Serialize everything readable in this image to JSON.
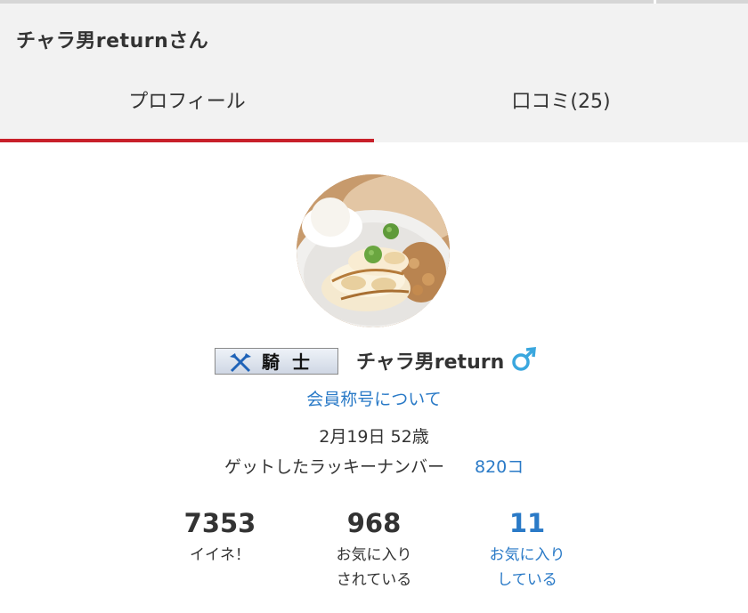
{
  "header": {
    "title": "チャラ男returnさん"
  },
  "tabs": [
    {
      "label": "プロフィール",
      "active": true
    },
    {
      "label": "口コミ(25)",
      "active": false
    }
  ],
  "colors": {
    "accent_red": "#c8202a",
    "link_blue": "#2a7ac7",
    "header_bg": "#f2f2f2"
  },
  "profile": {
    "avatar_icon": "pancake-photo-avatar",
    "badge": {
      "icon": "crossed-axes-icon",
      "label": "騎士"
    },
    "username": "チャラ男return",
    "gender_icon": "male-symbol-icon",
    "rank_link": "会員称号について",
    "birth": "2月19日 52歳",
    "lucky_label": "ゲットしたラッキーナンバー",
    "lucky_value": "820コ"
  },
  "stats": {
    "likes": {
      "value": "7353",
      "label": "イイネ！"
    },
    "favorited_by": {
      "value": "968",
      "label_line1": "お気に入り",
      "label_line2": "されている"
    },
    "favorites": {
      "value": "11",
      "label_line1": "お気に入り",
      "label_line2": "している"
    }
  }
}
